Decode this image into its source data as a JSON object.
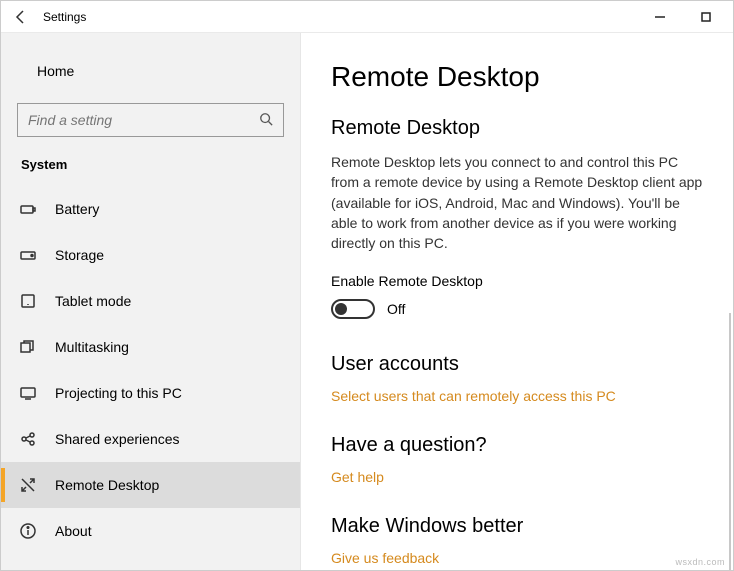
{
  "window": {
    "title": "Settings"
  },
  "sidebar": {
    "home_label": "Home",
    "search_placeholder": "Find a setting",
    "section_label": "System",
    "items": [
      {
        "icon": "battery-icon",
        "label": "Battery"
      },
      {
        "icon": "storage-icon",
        "label": "Storage"
      },
      {
        "icon": "tablet-icon",
        "label": "Tablet mode"
      },
      {
        "icon": "multitasking-icon",
        "label": "Multitasking"
      },
      {
        "icon": "projecting-icon",
        "label": "Projecting to this PC"
      },
      {
        "icon": "shared-icon",
        "label": "Shared experiences"
      },
      {
        "icon": "remote-icon",
        "label": "Remote Desktop"
      },
      {
        "icon": "about-icon",
        "label": "About"
      }
    ],
    "active_index": 6
  },
  "main": {
    "page_title": "Remote Desktop",
    "sections": {
      "intro": {
        "heading": "Remote Desktop",
        "description": "Remote Desktop lets you connect to and control this PC from a remote device by using a Remote Desktop client app (available for iOS, Android, Mac and Windows). You'll be able to work from another device as if you were working directly on this PC.",
        "toggle_label": "Enable Remote Desktop",
        "toggle_state": "Off"
      },
      "users": {
        "heading": "User accounts",
        "link": "Select users that can remotely access this PC"
      },
      "help": {
        "heading": "Have a question?",
        "link": "Get help"
      },
      "feedback": {
        "heading": "Make Windows better",
        "link": "Give us feedback"
      }
    }
  },
  "watermark": "wsxdn.com"
}
